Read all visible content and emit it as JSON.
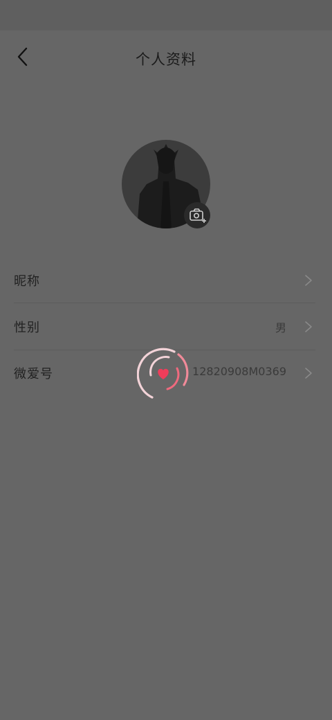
{
  "header": {
    "title": "个人资料",
    "back_icon": "chevron-left-icon"
  },
  "avatar": {
    "icon": "avatar-silhouette",
    "camera_icon": "camera-add-icon"
  },
  "rows": [
    {
      "label": "昵称",
      "value": ""
    },
    {
      "label": "性别",
      "value": "男"
    },
    {
      "label": "微爱号",
      "value": "12820908M0369"
    }
  ],
  "loading": {
    "icon": "heart-spinner-icon",
    "accent": "#ef6a7e"
  },
  "colors": {
    "overlay": "#666666",
    "text": "#222222"
  }
}
